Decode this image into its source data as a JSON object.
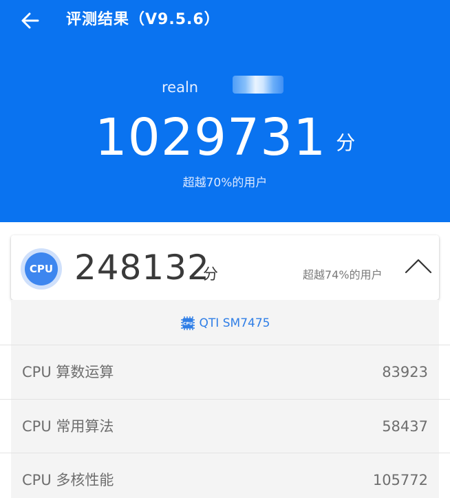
{
  "header": {
    "title": "评测结果（V9.5.6）",
    "device_name": "realn",
    "total_score": "1029731",
    "score_unit": "分",
    "total_rank": "超越70%的用户"
  },
  "cpu_card": {
    "badge": "CPU",
    "score": "248132",
    "score_unit": "分",
    "rank": "超越74%的用户"
  },
  "chip": {
    "icon_label": "CPU",
    "name": "QTI SM7475"
  },
  "sub_scores": [
    {
      "label": "CPU 算数运算",
      "value": "83923"
    },
    {
      "label": "CPU 常用算法",
      "value": "58437"
    },
    {
      "label": "CPU 多核性能",
      "value": "105772"
    }
  ],
  "colors": {
    "header_bg": "#0a73f0",
    "accent": "#3d86ef",
    "chip_text": "#2f7ee6"
  }
}
